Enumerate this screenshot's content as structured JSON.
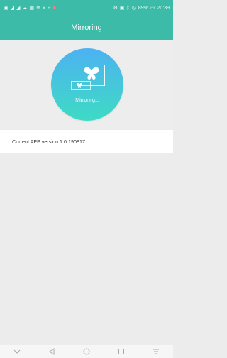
{
  "status_bar": {
    "left_icons": [
      "sim-icon",
      "signal-icon",
      "signal-icon",
      "cloud-icon",
      "image-icon",
      "wifi-icon",
      "location-icon",
      "parking-icon",
      "video-icon"
    ],
    "right_icons": [
      "vibrate-icon",
      "nfc-icon",
      "bluetooth-icon",
      "alarm-icon"
    ],
    "battery": "89%",
    "time": "20:39",
    "colors": {
      "background": "#3cbba9",
      "text": "#e8fbf7"
    }
  },
  "header": {
    "title": "Mirroring",
    "color": "#3cbba9"
  },
  "hero": {
    "status_label": "Mirroring...",
    "icon": "butterfly-icon",
    "gradient": [
      "#4cb2f2",
      "#45c9d8",
      "#3ddbc4"
    ]
  },
  "version": {
    "text": "Current APP version:1.0.190817"
  },
  "nav_bar": {
    "buttons": [
      "chevron-down-icon",
      "back-icon",
      "home-icon",
      "recents-icon",
      "notification-icon"
    ]
  }
}
